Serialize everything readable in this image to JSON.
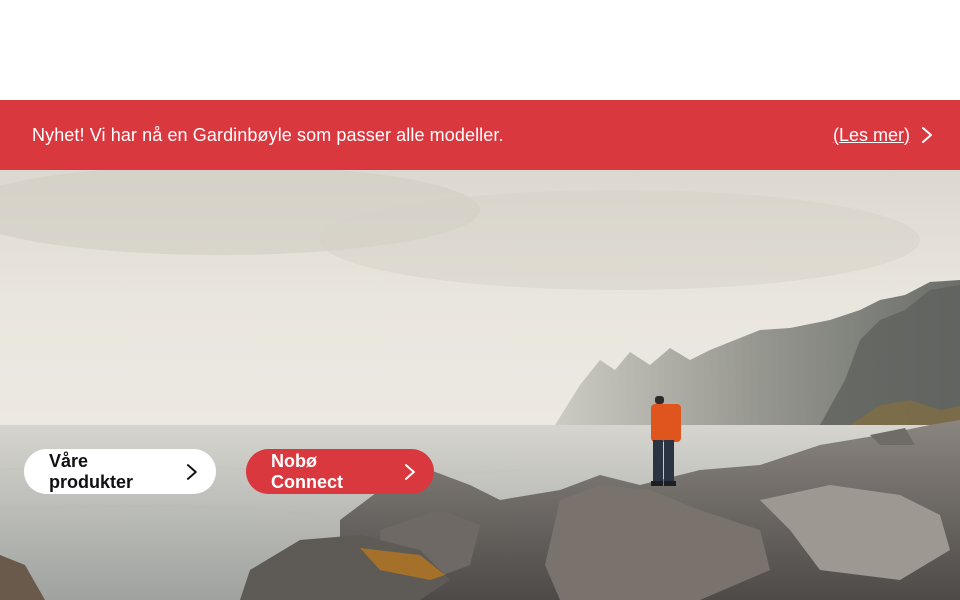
{
  "announcement": {
    "text": "Nyhet! Vi har nå en Gardinbøyle som passer alle modeller.",
    "link_label": "(Les mer)",
    "link_icon": "chevron-right-icon",
    "background_color": "#d9383f"
  },
  "hero": {
    "image_subject": "hiker-on-rocky-coast",
    "buttons": {
      "products_label": "Våre produkter",
      "connect_label": "Nobø Connect",
      "icon": "chevron-right-icon"
    },
    "colors": {
      "accent": "#d9383f",
      "button_light": "#ffffff"
    }
  }
}
